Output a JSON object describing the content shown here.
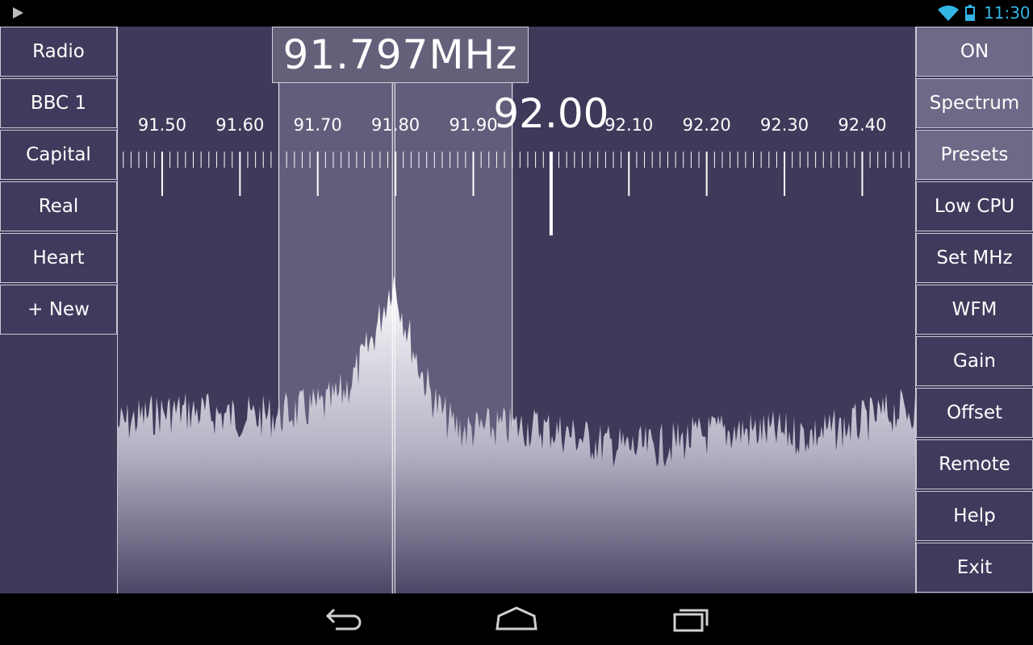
{
  "status_bar": {
    "time": "11:30",
    "icons": [
      "play-icon",
      "wifi-icon",
      "battery-icon"
    ],
    "time_color": "#33b5e5"
  },
  "left_panel": {
    "items": [
      {
        "label": "Radio"
      },
      {
        "label": "BBC 1"
      },
      {
        "label": "Capital"
      },
      {
        "label": "Real"
      },
      {
        "label": "Heart"
      },
      {
        "label": "+ New"
      }
    ]
  },
  "right_panel": {
    "items": [
      {
        "label": "ON",
        "active": true
      },
      {
        "label": "Spectrum",
        "active": true
      },
      {
        "label": "Presets",
        "active": true
      },
      {
        "label": "Low CPU"
      },
      {
        "label": "Set MHz"
      },
      {
        "label": "WFM"
      },
      {
        "label": "Gain"
      },
      {
        "label": "Offset"
      },
      {
        "label": "Remote"
      },
      {
        "label": "Help"
      },
      {
        "label": "Exit"
      }
    ]
  },
  "tuner": {
    "frequency_display": "91.797MHz",
    "tuned_mhz": 91.797,
    "bandwidth_low_mhz": 91.65,
    "bandwidth_high_mhz": 91.95,
    "scale_min_mhz": 91.443,
    "scale_max_mhz": 92.468,
    "scale_labels": [
      "91.50",
      "91.60",
      "91.70",
      "91.80",
      "91.90",
      "92.10",
      "92.20",
      "92.30",
      "92.40"
    ],
    "scale_label_values": [
      91.5,
      91.6,
      91.7,
      91.8,
      91.9,
      92.1,
      92.2,
      92.3,
      92.4
    ],
    "center_label": "92.00",
    "center_value": 92.0
  },
  "colors": {
    "background": "#3d3a5a",
    "button": "#3e3b5c",
    "button_active": "#6c6a87",
    "passband": "#615e7b"
  },
  "nav_bar": {
    "icons": [
      "back-icon",
      "home-icon",
      "recent-apps-icon"
    ]
  }
}
